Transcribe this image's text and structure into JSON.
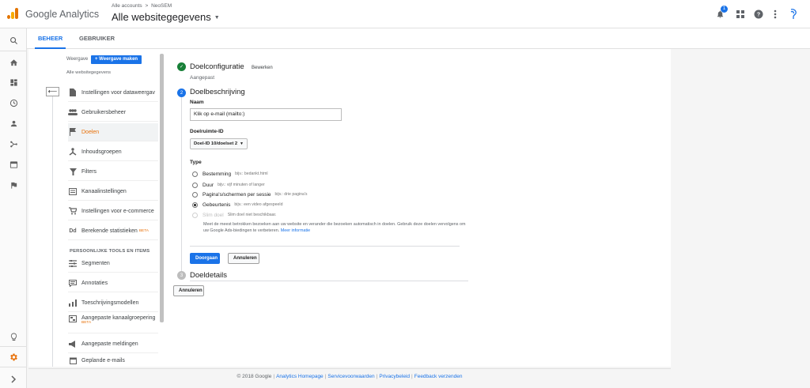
{
  "header": {
    "product": "Google Analytics",
    "breadcrumb": [
      "Alle accounts",
      "NeoSEM"
    ],
    "breadcrumb_sep": ">",
    "view_title": "Alle websitegegevens",
    "notification_count": "1"
  },
  "tabs": [
    {
      "label": "BEHEER",
      "active": true
    },
    {
      "label": "GEBRUIKER",
      "active": false
    }
  ],
  "view_panel": {
    "view_label": "Weergave",
    "make_view_button": "+ Weergave maken",
    "current_view": "Alle websitegegevens"
  },
  "menu": [
    {
      "label": "Instellingen voor dataweergav",
      "icon": "document-icon"
    },
    {
      "label": "Gebruikersbeheer",
      "icon": "people-icon"
    },
    {
      "label": "Doelen",
      "icon": "flag-icon",
      "active": true
    },
    {
      "label": "Inhoudsgroepen",
      "icon": "content-group-icon"
    },
    {
      "label": "Filters",
      "icon": "filter-icon"
    },
    {
      "label": "Kanaalinstellingen",
      "icon": "channel-icon"
    },
    {
      "label": "Instellingen voor e-commerce",
      "icon": "cart-icon"
    },
    {
      "label": "Berekende statistieken",
      "icon": "calculated-icon",
      "badge": "BETA"
    }
  ],
  "personal_section": {
    "label": "PERSOONLIJKE TOOLS EN ITEMS",
    "items": [
      {
        "label": "Segmenten",
        "icon": "segments-icon"
      },
      {
        "label": "Annotaties",
        "icon": "annotation-icon"
      },
      {
        "label": "Toeschrijvingsmodellen",
        "icon": "attribution-icon"
      },
      {
        "label": "Aangepaste kanaalgroepering",
        "icon": "channel-grouping-icon",
        "badge": "BETA"
      },
      {
        "label": "Aangepaste meldingen",
        "icon": "megaphone-icon"
      },
      {
        "label": "Geplande e-mails",
        "icon": "calendar-icon"
      }
    ]
  },
  "goal_config": {
    "title": "Doelconfiguratie",
    "edit_label": "Bewerken",
    "status": "Aangepast"
  },
  "goal_description": {
    "step_number": "2",
    "title": "Doelbeschrijving",
    "name_label": "Naam",
    "name_value": "Klik op e-mail (mailto:)",
    "slot_label": "Doelruimte-ID",
    "slot_value": "Doel-ID 10/doelset 2",
    "type_label": "Type",
    "types": [
      {
        "label": "Bestemming",
        "example": "bijv.: bedankt.html",
        "checked": false,
        "disabled": false
      },
      {
        "label": "Duur",
        "example": "bijv.: vijf minuten of langer",
        "checked": false,
        "disabled": false
      },
      {
        "label": "Pagina's/schermen per sessie",
        "example": "bijv.: drie pagina's",
        "checked": false,
        "disabled": false
      },
      {
        "label": "Gebeurtenis",
        "example": "bijv.: een video afgespeeld",
        "checked": true,
        "disabled": false
      },
      {
        "label": "Slim doel",
        "example": "Slim doel niet beschikbaar.",
        "checked": false,
        "disabled": true
      }
    ],
    "help_text": "Meet de meest betrokken bezoeken aan uw website en verander die bezoeken automatisch in doelen. Gebruik deze doelen vervolgens om uw Google Ads-biedingen te verbeteren.",
    "help_link": "Meer informatie",
    "continue_button": "Doorgaan",
    "cancel_button": "Annuleren"
  },
  "goal_details": {
    "step_number": "3",
    "title": "Doeldetails",
    "cancel_button": "Annuleren"
  },
  "footer": {
    "copyright": "© 2018 Google",
    "links": [
      "Analytics Homepage",
      "Servicevoorwaarden",
      "Privacybeleid",
      "Feedback verzenden"
    ]
  },
  "colors": {
    "accent": "#1a73e8",
    "active_menu": "#e8710a",
    "done": "#188038"
  }
}
